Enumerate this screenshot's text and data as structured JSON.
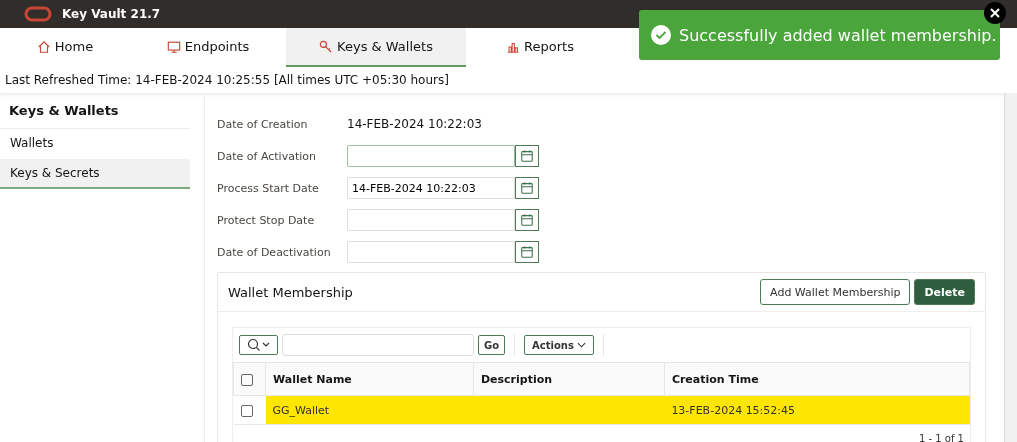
{
  "app": {
    "title": "Key Vault 21.7"
  },
  "tabs": [
    {
      "label": "Home",
      "selected": false
    },
    {
      "label": "Endpoints",
      "selected": false
    },
    {
      "label": "Keys & Wallets",
      "selected": true
    },
    {
      "label": "Reports",
      "selected": false
    }
  ],
  "refresh": "Last Refreshed Time: 14-FEB-2024 10:25:55 [All times UTC +05:30 hours]",
  "toast": {
    "message": "Successfully added wallet membership."
  },
  "sidebar": {
    "title": "Keys & Wallets",
    "items": [
      {
        "label": "Wallets",
        "selected": false
      },
      {
        "label": "Keys & Secrets",
        "selected": true
      }
    ]
  },
  "details": [
    {
      "label": "Date of Creation",
      "kind": "text",
      "value": "14-FEB-2024 10:22:03"
    },
    {
      "label": "Date of Activation",
      "kind": "date",
      "focused": true
    },
    {
      "label": "Process Start Date",
      "kind": "date",
      "value": "14-FEB-2024 10:22:03",
      "focused": false
    },
    {
      "label": "Protect Stop Date",
      "kind": "date",
      "focused": false
    },
    {
      "label": "Date of Deactivation",
      "kind": "date",
      "focused": false
    }
  ],
  "membership": {
    "title": "Wallet Membership",
    "add_button": "Add Wallet Membership",
    "delete_button": "Delete",
    "go_button": "Go",
    "actions_button": "Actions",
    "select_all_checked": false,
    "columns": [
      "Wallet Name",
      "Description",
      "Creation Time"
    ],
    "rows": [
      {
        "cells": [
          "GG_Wallet",
          "",
          "13-FEB-2024 15:52:45"
        ],
        "checked": false,
        "highlighted": true
      }
    ],
    "pagination": "1 - 1 of 1"
  }
}
